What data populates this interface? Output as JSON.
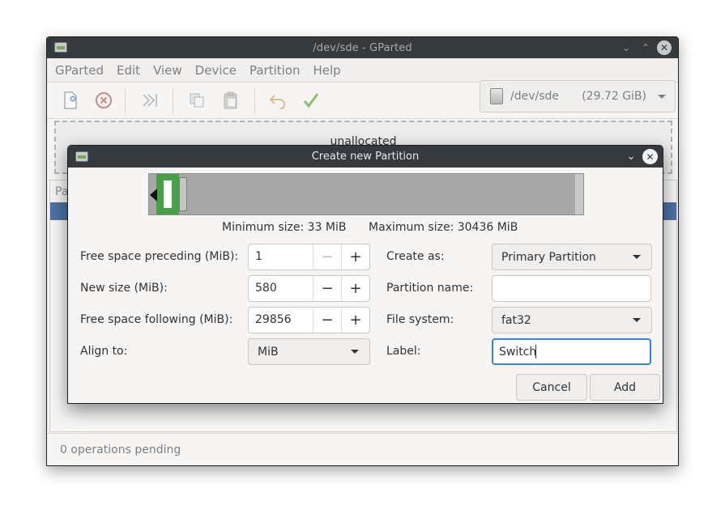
{
  "main_window": {
    "title": "/dev/sde - GParted",
    "menu": [
      "GParted",
      "Edit",
      "View",
      "Device",
      "Partition",
      "Help"
    ],
    "device": "/dev/sde",
    "device_size": "(29.72 GiB)",
    "unallocated_label": "unallocated",
    "partition_header_fragment": "Pa",
    "status": "0 operations pending",
    "toolbar_icons": [
      "new-partition-icon",
      "delete-partition-icon",
      "resize-move-icon",
      "copy-icon",
      "paste-icon",
      "undo-icon",
      "apply-icon"
    ]
  },
  "dialog": {
    "title": "Create new Partition",
    "minimum_size": "Minimum size: 33 MiB",
    "maximum_size": "Maximum size: 30436 MiB",
    "partition_fill_fraction": 0.019,
    "left": {
      "free_preceding_label": "Free space preceding (MiB):",
      "free_preceding_value": "1",
      "new_size_label": "New size (MiB):",
      "new_size_value": "580",
      "free_following_label": "Free space following (MiB):",
      "free_following_value": "29856",
      "align_label": "Align to:",
      "align_value": "MiB"
    },
    "right": {
      "create_as_label": "Create as:",
      "create_as_value": "Primary Partition",
      "partition_name_label": "Partition name:",
      "partition_name_value": "",
      "file_system_label": "File system:",
      "file_system_value": "fat32",
      "label_label": "Label:",
      "label_value": "Switch"
    },
    "buttons": {
      "cancel": "Cancel",
      "add": "Add"
    },
    "colors": {
      "partition": "#46a046",
      "focus": "#3584e4",
      "titlebar": "#353a3e"
    }
  }
}
